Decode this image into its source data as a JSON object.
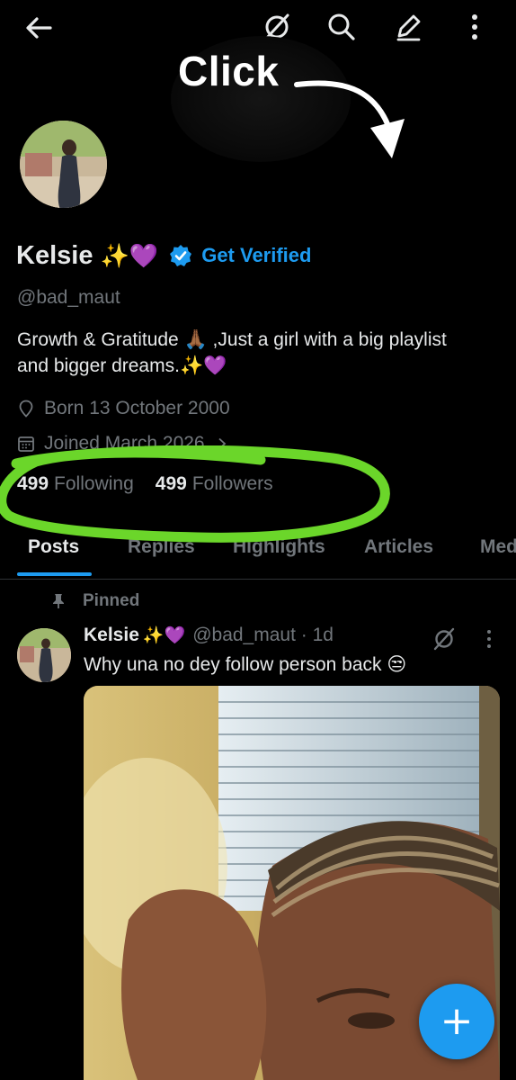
{
  "annotation": {
    "click_label": "Click"
  },
  "profile": {
    "display_name": "Kelsie",
    "name_emoji": "✨💜",
    "get_verified": "Get Verified",
    "handle": "@bad_maut",
    "bio_line1": "Growth & Gratitude 🙏🏾 ,Just a girl with a big playlist",
    "bio_line2": "and bigger dreams.✨💜",
    "born": "Born 13 October 2000",
    "joined": "Joined March 2026"
  },
  "stats": {
    "following_count": "499",
    "following_label": "Following",
    "followers_count": "499",
    "followers_label": "Followers"
  },
  "tabs": [
    "Posts",
    "Replies",
    "Highlights",
    "Articles",
    "Media"
  ],
  "pinned_label": "Pinned",
  "post": {
    "author": "Kelsie",
    "author_emoji": "✨💜",
    "handle_time": "@bad_maut · 1d",
    "text": "Why una no dey follow person back 😒"
  },
  "colors": {
    "accent": "#1d9bf0",
    "annotation_green": "#6bd62a",
    "muted": "#71767b"
  },
  "icons": {
    "back": "arrow-left-icon",
    "grok": "grok-icon",
    "search": "search-icon",
    "edit": "pencil-icon",
    "more": "more-vertical-icon",
    "fab": "plus-icon"
  }
}
